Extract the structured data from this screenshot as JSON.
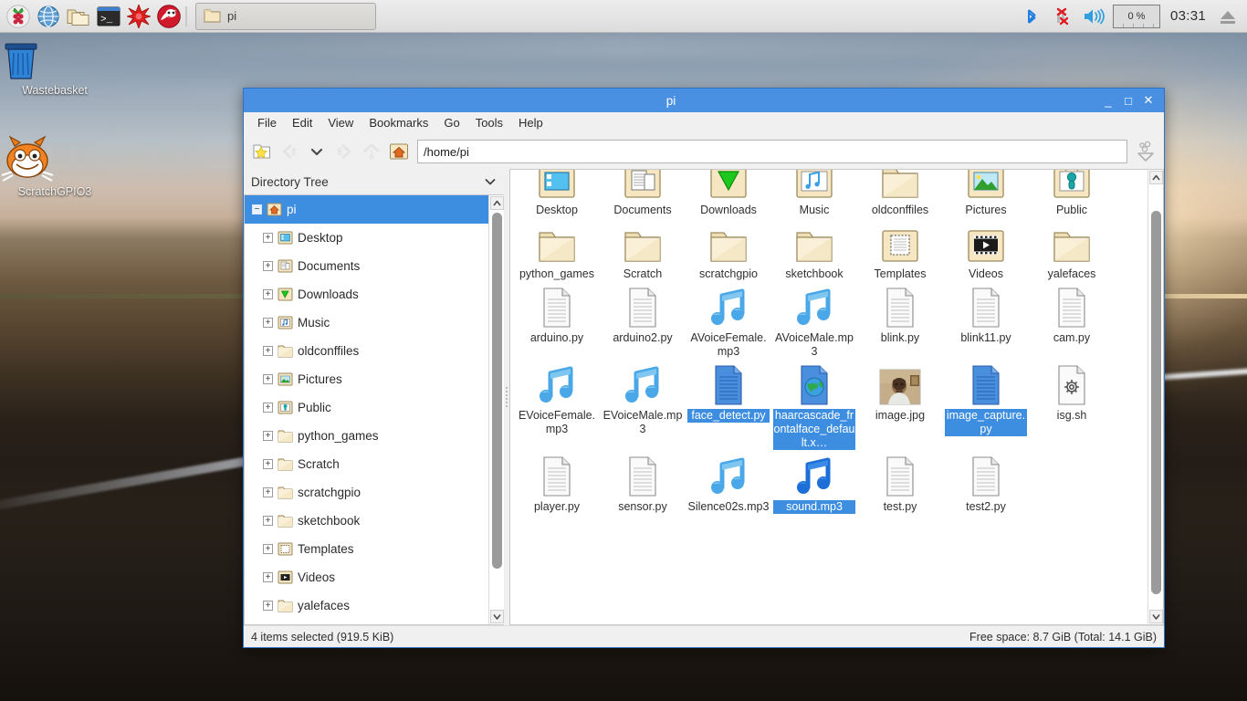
{
  "panel": {
    "launchers": [
      {
        "name": "raspberry-menu-icon",
        "label": "Menu"
      },
      {
        "name": "web-browser-icon",
        "label": "Web Browser"
      },
      {
        "name": "file-manager-icon",
        "label": "File Manager"
      },
      {
        "name": "terminal-icon",
        "label": "Terminal"
      },
      {
        "name": "mathematica-icon",
        "label": "Mathematica"
      },
      {
        "name": "wolfram-icon",
        "label": "Wolfram"
      }
    ],
    "task_button": {
      "label": "pi"
    },
    "tray": {
      "bluetooth": "bluetooth-icon",
      "network": "network-disconnected-icon",
      "volume": "volume-icon",
      "cpu_label": "0 %",
      "clock": "03:31",
      "eject": "eject-icon"
    }
  },
  "desktop_icons": [
    {
      "label": "Wastebasket",
      "icon": "wastebasket-icon"
    },
    {
      "label": "ScratchGPIO3",
      "icon": "scratch-cat-icon"
    }
  ],
  "window": {
    "title": "pi",
    "buttons": {
      "minimize": "_",
      "maximize": "□",
      "close": "✕"
    },
    "menus": [
      "File",
      "Edit",
      "View",
      "Bookmarks",
      "Go",
      "Tools",
      "Help"
    ],
    "toolbar": {
      "new_tab": "new-tab-icon",
      "back": "back-icon",
      "history": "history-dropdown-icon",
      "forward": "forward-icon",
      "up": "go-up-icon",
      "home": "home-icon",
      "path": "/home/pi",
      "view_options": "view-options-icon"
    },
    "sidebar": {
      "header": "Directory Tree",
      "root": {
        "label": "pi",
        "icon": "home-folder-icon",
        "expanded": true,
        "selected": true
      },
      "items": [
        {
          "label": "Desktop",
          "icon": "desktop-folder-icon"
        },
        {
          "label": "Documents",
          "icon": "documents-folder-icon"
        },
        {
          "label": "Downloads",
          "icon": "downloads-folder-icon"
        },
        {
          "label": "Music",
          "icon": "music-folder-icon"
        },
        {
          "label": "oldconffiles",
          "icon": "plain-folder-icon"
        },
        {
          "label": "Pictures",
          "icon": "pictures-folder-icon"
        },
        {
          "label": "Public",
          "icon": "public-folder-icon"
        },
        {
          "label": "python_games",
          "icon": "plain-folder-icon"
        },
        {
          "label": "Scratch",
          "icon": "plain-folder-icon"
        },
        {
          "label": "scratchgpio",
          "icon": "plain-folder-icon"
        },
        {
          "label": "sketchbook",
          "icon": "plain-folder-icon"
        },
        {
          "label": "Templates",
          "icon": "templates-folder-icon"
        },
        {
          "label": "Videos",
          "icon": "videos-folder-icon"
        },
        {
          "label": "yalefaces",
          "icon": "plain-folder-icon"
        }
      ]
    },
    "files": [
      {
        "name": "Desktop",
        "icon": "desktop-folder-icon",
        "selected": false
      },
      {
        "name": "Documents",
        "icon": "documents-folder-icon",
        "selected": false
      },
      {
        "name": "Downloads",
        "icon": "downloads-folder-icon",
        "selected": false
      },
      {
        "name": "Music",
        "icon": "music-folder-icon",
        "selected": false
      },
      {
        "name": "oldconffiles",
        "icon": "plain-folder-icon",
        "selected": false
      },
      {
        "name": "Pictures",
        "icon": "pictures-folder-icon",
        "selected": false
      },
      {
        "name": "Public",
        "icon": "public-folder-icon",
        "selected": false
      },
      {
        "name": "python_games",
        "icon": "plain-folder-icon",
        "selected": false
      },
      {
        "name": "Scratch",
        "icon": "plain-folder-icon",
        "selected": false
      },
      {
        "name": "scratchgpio",
        "icon": "plain-folder-icon",
        "selected": false
      },
      {
        "name": "sketchbook",
        "icon": "plain-folder-icon",
        "selected": false
      },
      {
        "name": "Templates",
        "icon": "templates-folder-icon",
        "selected": false
      },
      {
        "name": "Videos",
        "icon": "videos-folder-icon",
        "selected": false
      },
      {
        "name": "yalefaces",
        "icon": "plain-folder-icon",
        "selected": false
      },
      {
        "name": "arduino.py",
        "icon": "text-file-icon",
        "selected": false
      },
      {
        "name": "arduino2.py",
        "icon": "text-file-icon",
        "selected": false
      },
      {
        "name": "AVoiceFemale.mp3",
        "icon": "audio-file-icon",
        "selected": false
      },
      {
        "name": "AVoiceMale.mp3",
        "icon": "audio-file-icon",
        "selected": false
      },
      {
        "name": "blink.py",
        "icon": "text-file-icon",
        "selected": false
      },
      {
        "name": "blink11.py",
        "icon": "text-file-icon",
        "selected": false
      },
      {
        "name": "cam.py",
        "icon": "text-file-icon",
        "selected": false
      },
      {
        "name": "EVoiceFemale.mp3",
        "icon": "audio-file-icon",
        "selected": false
      },
      {
        "name": "EVoiceMale.mp3",
        "icon": "audio-file-icon",
        "selected": false
      },
      {
        "name": "face_detect.py",
        "icon": "blue-text-file-icon",
        "selected": true
      },
      {
        "name": "haarcascade_frontalface_default.x…",
        "icon": "xml-file-icon",
        "selected": true
      },
      {
        "name": "image.jpg",
        "icon": "image-thumbnail-icon",
        "selected": false
      },
      {
        "name": "image_capture.py",
        "icon": "blue-text-file-icon",
        "selected": true
      },
      {
        "name": "isg.sh",
        "icon": "script-file-icon",
        "selected": false
      },
      {
        "name": "player.py",
        "icon": "text-file-icon",
        "selected": false
      },
      {
        "name": "sensor.py",
        "icon": "text-file-icon",
        "selected": false
      },
      {
        "name": "Silence02s.mp3",
        "icon": "audio-file-icon",
        "selected": false
      },
      {
        "name": "sound.mp3",
        "icon": "audio-file-selected-icon",
        "selected": true
      },
      {
        "name": "test.py",
        "icon": "text-file-icon",
        "selected": false
      },
      {
        "name": "test2.py",
        "icon": "text-file-icon",
        "selected": false
      }
    ],
    "status": {
      "left": "4 items selected (919.5 KiB)",
      "right": "Free space: 8.7 GiB (Total: 14.1 GiB)"
    }
  },
  "colors": {
    "titlebar": "#4a90e2",
    "selection": "#3d8ee0",
    "panel": "#e4e4e4",
    "window_bg": "#f0f0f0"
  }
}
